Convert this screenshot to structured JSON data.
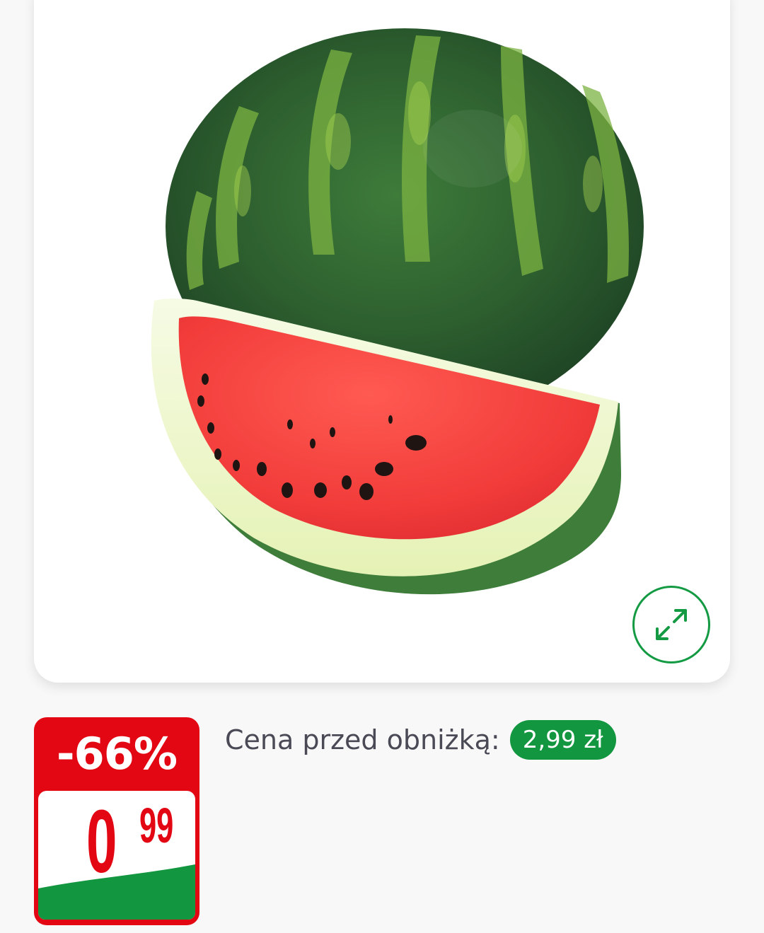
{
  "product": {
    "image_alt": "watermelon-image"
  },
  "controls": {
    "zoom_icon": "expand-arrows-icon"
  },
  "price": {
    "discount": "-66%",
    "integer": "0",
    "decimal": "99"
  },
  "previous_price": {
    "label": "Cena przed obniżką:",
    "value": "2,99 zł"
  },
  "colors": {
    "brand_green": "#12963f",
    "brand_red": "#e30613",
    "text_gray": "#4a4a56"
  }
}
